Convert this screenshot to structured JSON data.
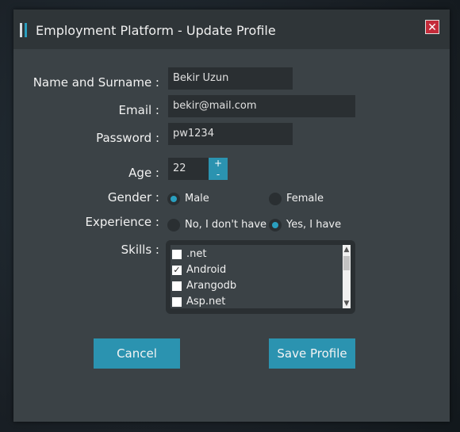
{
  "window": {
    "title": "Employment Platform - Update Profile",
    "close_label": "✕"
  },
  "form": {
    "name_label": "Name and Surname :",
    "name_value": "Bekir Uzun",
    "email_label": "Email :",
    "email_value": "bekir@mail.com",
    "password_label": "Password :",
    "password_value": "pw1234",
    "age_label": "Age :",
    "age_value": "22",
    "age_plus": "+",
    "age_minus": "-",
    "gender_label": "Gender :",
    "gender_options": [
      {
        "label": "Male",
        "selected": true
      },
      {
        "label": "Female",
        "selected": false
      }
    ],
    "experience_label": "Experience :",
    "experience_options": [
      {
        "label": "No, I don't have",
        "selected": false
      },
      {
        "label": "Yes, I have",
        "selected": true
      }
    ],
    "skills_label": "Skills :",
    "skills": [
      {
        "label": ".net",
        "checked": false
      },
      {
        "label": "Android",
        "checked": true
      },
      {
        "label": "Arangodb",
        "checked": false
      },
      {
        "label": "Asp.net",
        "checked": false
      }
    ],
    "check_mark": "✓"
  },
  "actions": {
    "cancel_label": "Cancel",
    "save_label": "Save Profile"
  },
  "colors": {
    "accent": "#2b93b0",
    "window_bg": "#3b4246",
    "field_bg": "#2a2f32",
    "close_red": "#c42b3a"
  }
}
